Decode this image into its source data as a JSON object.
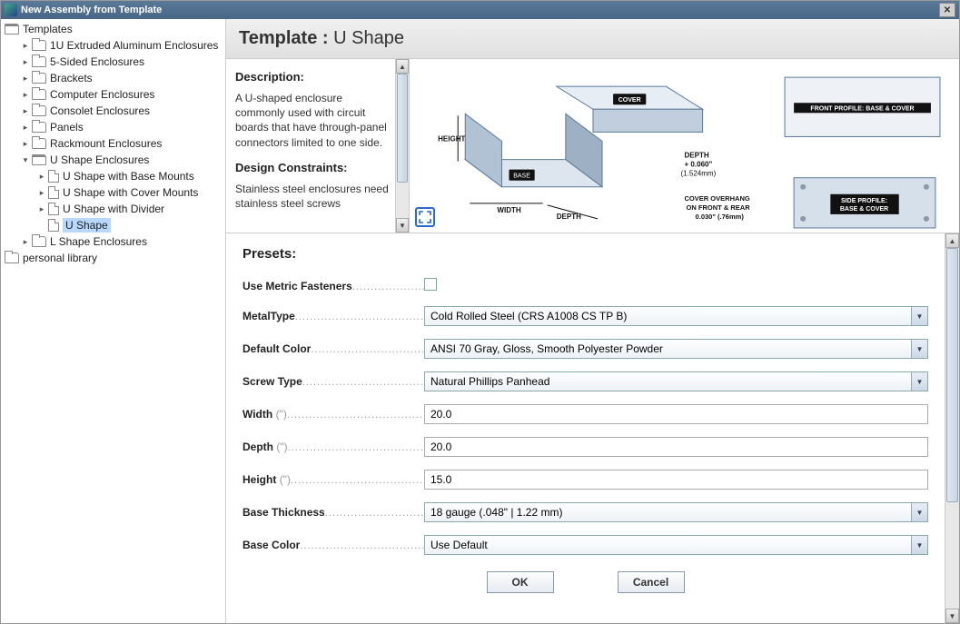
{
  "window": {
    "title": "New Assembly from Template"
  },
  "tree": {
    "root1": "Templates",
    "items": [
      "1U Extruded Aluminum Enclosures",
      "5-Sided Enclosures",
      "Brackets",
      "Computer Enclosures",
      "Consolet Enclosures",
      "Panels",
      "Rackmount Enclosures"
    ],
    "ushape_folder": "U Shape Enclosures",
    "ushape_children": [
      "U Shape with Base Mounts",
      "U Shape with Cover Mounts",
      "U Shape with Divider",
      "U Shape"
    ],
    "lshape": "L Shape Enclosures",
    "root2": "personal library"
  },
  "template": {
    "prefix": "Template :",
    "name": "U Shape",
    "desc_h": "Description:",
    "desc_p": "A U-shaped enclosure commonly used with circuit boards that have through-panel connectors limited to one side.",
    "dc_h": "Design Constraints:",
    "dc_p": "Stainless steel enclosures need stainless steel screws"
  },
  "diagram": {
    "height": "HEIGHT",
    "base": "BASE",
    "width": "WIDTH",
    "depth": "DEPTH",
    "cover": "COVER",
    "depth_note1": "DEPTH",
    "depth_note2": "+ 0.060\"",
    "depth_note3": "(1.524mm)",
    "overhang_1": "COVER OVERHANG",
    "overhang_2": "ON FRONT & REAR",
    "overhang_3": "0.030\" (.76mm)",
    "front_profile": "FRONT PROFILE: BASE & COVER",
    "side_profile_1": "SIDE PROFILE:",
    "side_profile_2": "BASE & COVER"
  },
  "presets": {
    "title": "Presets:",
    "metric_label": "Use Metric Fasteners",
    "metaltype_label": "MetalType",
    "metaltype_value": "Cold Rolled Steel (CRS A1008 CS TP B)",
    "color_label": "Default Color",
    "color_value": "ANSI 70 Gray, Gloss, Smooth Polyester Powder",
    "screw_label": "Screw Type",
    "screw_value": "Natural Phillips Panhead",
    "width_label": "Width",
    "width_unit": "(\")",
    "width_value": "20.0",
    "depth_label": "Depth",
    "depth_unit": "(\")",
    "depth_value": "20.0",
    "height_label": "Height",
    "height_unit": "(\")",
    "height_value": "15.0",
    "baseth_label": "Base Thickness",
    "baseth_value": "18 gauge (.048\" | 1.22 mm)",
    "basec_label": "Base Color",
    "basec_value": "Use Default",
    "ok": "OK",
    "cancel": "Cancel"
  }
}
